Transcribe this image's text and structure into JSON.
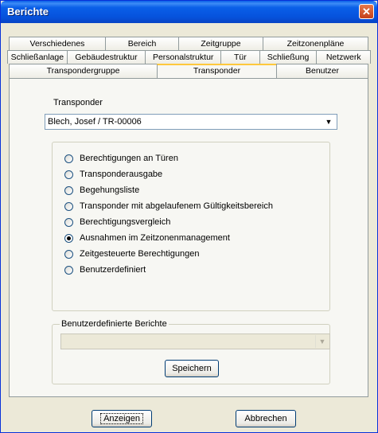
{
  "window": {
    "title": "Berichte",
    "close_glyph": "✕"
  },
  "tabs": {
    "row1": [
      "Verschiedenes",
      "Bereich",
      "Zeitgruppe",
      "Zeitzonenpläne"
    ],
    "row2": [
      "Schließanlage",
      "Gebäudestruktur",
      "Personalstruktur",
      "Tür",
      "Schließung",
      "Netzwerk"
    ],
    "row3": [
      "Transpondergruppe",
      "Transponder",
      "Benutzer"
    ],
    "active": "Transponder"
  },
  "transponder": {
    "label": "Transponder",
    "selected": "Blech, Josef / TR-00006"
  },
  "report_options": [
    {
      "label": "Berechtigungen an Türen",
      "selected": false
    },
    {
      "label": "Transponderausgabe",
      "selected": false
    },
    {
      "label": "Begehungsliste",
      "selected": false
    },
    {
      "label": "Transponder mit abgelaufenem Gültigkeitsbereich",
      "selected": false
    },
    {
      "label": "Berechtigungsvergleich",
      "selected": false
    },
    {
      "label": "Ausnahmen im Zeitzonenmanagement",
      "selected": true
    },
    {
      "label": "Zeitgesteuerte Berechtigungen",
      "selected": false
    },
    {
      "label": "Benutzerdefiniert",
      "selected": false
    }
  ],
  "custom_reports": {
    "group_title": "Benutzerdefinierte Berichte",
    "selected": "",
    "save_label": "Speichern"
  },
  "footer": {
    "show_label": "Anzeigen",
    "cancel_label": "Abbrechen"
  },
  "icons": {
    "dropdown": "chevron-down-icon",
    "close": "close-icon"
  },
  "colors": {
    "title_bar": "#0A5FE8",
    "dialog_bg": "#ECE9D8",
    "active_tab_accent": "#FFC83C",
    "radio_selected": "#000000"
  }
}
